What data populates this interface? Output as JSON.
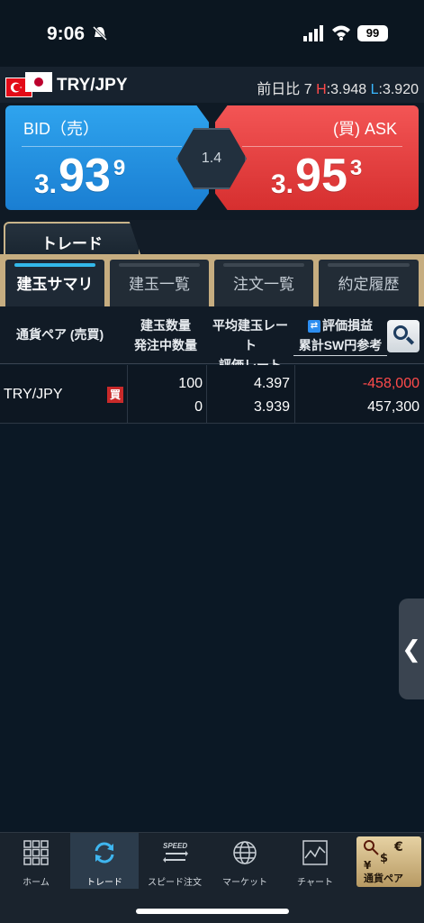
{
  "status_bar": {
    "time": "9:06",
    "battery": "99"
  },
  "pair_bar": {
    "pair": "TRY/JPY",
    "change_label": "前日比",
    "change_value": "7",
    "high_label": "H",
    "high_value": ":3.948",
    "low_label": "L",
    "low_value": ":3.920"
  },
  "bid": {
    "label": "BID（売）",
    "price_small": "3.",
    "price_big": "93",
    "price_sup": "9"
  },
  "ask": {
    "label": "(買) ASK",
    "price_small": "3.",
    "price_big": "95",
    "price_sup": "3"
  },
  "spread": "1.4",
  "trade_tab": "トレード",
  "sub_tabs": [
    {
      "label": "建玉サマリ"
    },
    {
      "label": "建玉一覧"
    },
    {
      "label": "注文一覧"
    },
    {
      "label": "約定履歴"
    }
  ],
  "table_header": {
    "pair": "通貨ペア (売買)",
    "qty_line1": "建玉数量",
    "qty_line2": "発注中数量",
    "rate_line1": "平均建玉レート",
    "rate_line2": "評価レート",
    "pl_line1": "評価損益",
    "pl_line2": "累計SW円参考"
  },
  "rows": [
    {
      "pair": "TRY/JPY",
      "side": "買",
      "qty": "100",
      "pending": "0",
      "avg_rate": "4.397",
      "eval_rate": "3.939",
      "pl": "-458,000",
      "swap": "457,300"
    }
  ],
  "bottom_nav": [
    {
      "label": "ホーム",
      "icon": "grid-icon"
    },
    {
      "label": "トレード",
      "icon": "refresh-icon"
    },
    {
      "label": "スピード注文",
      "icon": "speed-icon"
    },
    {
      "label": "マーケット",
      "icon": "globe-icon"
    },
    {
      "label": "チャート",
      "icon": "chart-icon"
    },
    {
      "label": "通貨ペア",
      "icon": "currency-icon"
    }
  ],
  "colors": {
    "bid": "#1a7ed2",
    "ask": "#d62f2f",
    "accent_tab": "#33b8ea",
    "negative": "#ff4b4b"
  }
}
